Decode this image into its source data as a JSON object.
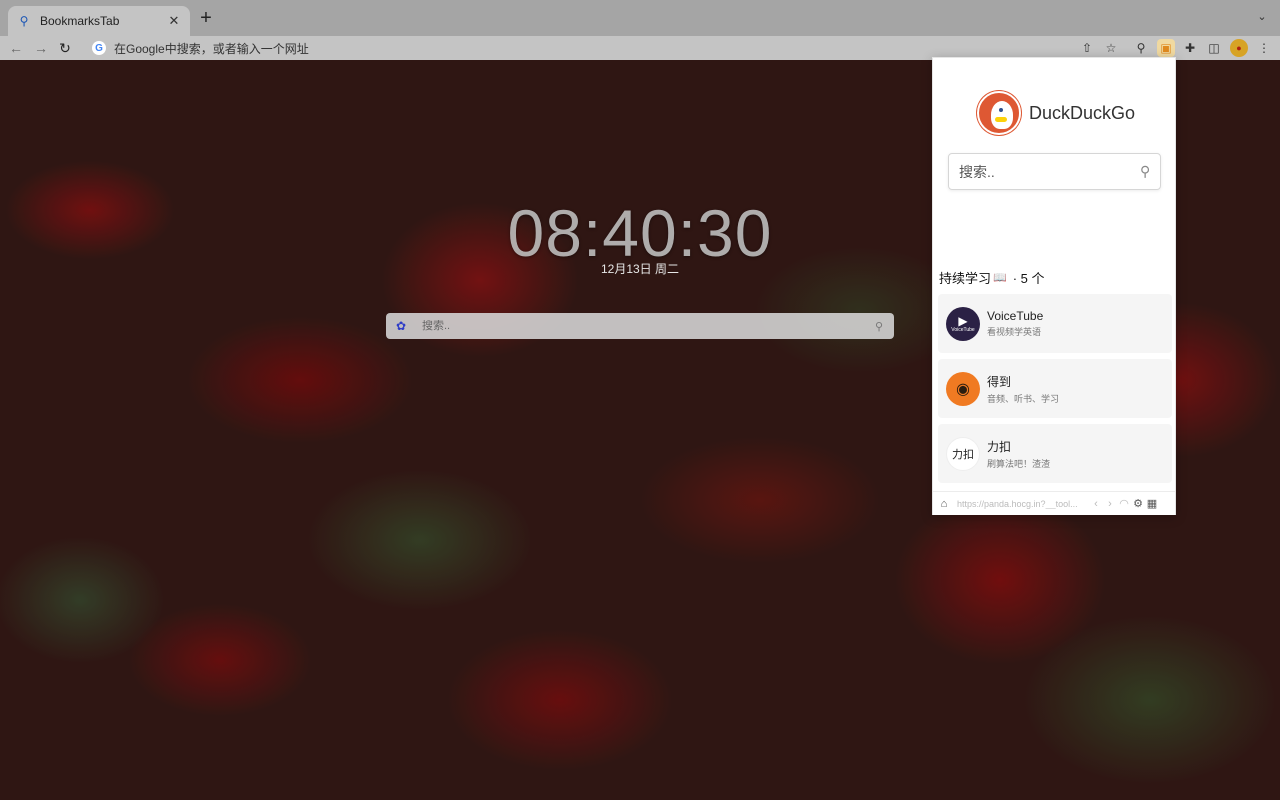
{
  "browser": {
    "tab_title": "BookmarksTab",
    "tab_favicon": "search-icon",
    "new_tab": "+",
    "omnibox_placeholder": "在Google中搜索，或者输入一个网址"
  },
  "page": {
    "clock": "08:40:30",
    "date": "12月13日 周二",
    "search_placeholder": "搜索.."
  },
  "popup": {
    "brand": "DuckDuckGo",
    "search_placeholder": "搜索..",
    "group": {
      "title": "持续学习",
      "count": "· 5 个"
    },
    "bookmarks": [
      {
        "name": "VoiceTube",
        "desc": "看视频学英语",
        "icon": "voicetube-icon",
        "icon_text": "VoiceTube"
      },
      {
        "name": "得到",
        "desc": "音频、听书、学习",
        "icon": "dedao-owl-icon"
      },
      {
        "name": "力扣",
        "desc": "刷算法吧！渣渣",
        "icon": "leetcode-icon",
        "icon_text": "力扣"
      }
    ],
    "footer_url": "https://panda.hocg.in?__tool..."
  },
  "colors": {
    "ddg_orange": "#de5833",
    "baidu_blue": "#2e3cc7",
    "dedao_orange": "#f07a22",
    "voicetube_purple": "#2b2145"
  }
}
